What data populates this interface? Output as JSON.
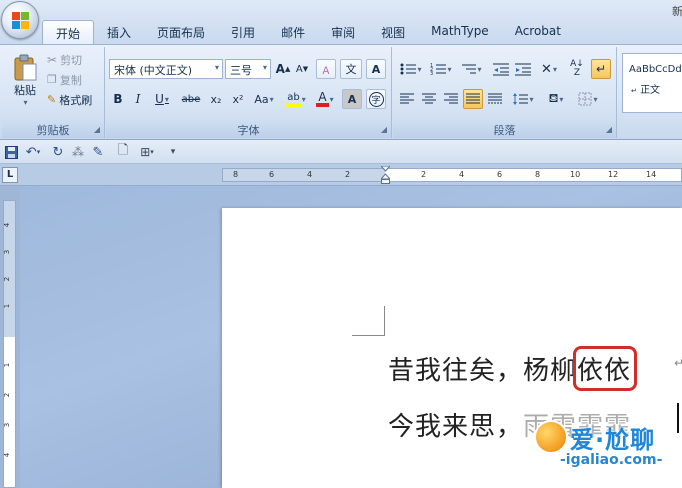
{
  "title_fragment": "新",
  "tabs": [
    {
      "label": "开始",
      "active": true
    },
    {
      "label": "插入"
    },
    {
      "label": "页面布局"
    },
    {
      "label": "引用"
    },
    {
      "label": "邮件"
    },
    {
      "label": "审阅"
    },
    {
      "label": "视图"
    },
    {
      "label": "MathType"
    },
    {
      "label": "Acrobat"
    }
  ],
  "clipboard": {
    "group_label": "剪贴板",
    "paste": "粘贴",
    "cut": "剪切",
    "copy": "复制",
    "format_painter": "格式刷"
  },
  "font": {
    "group_label": "字体",
    "font_name": "宋体 (中文正文)",
    "font_size": "三号",
    "buttons": {
      "grow": "A",
      "shrink": "A",
      "bold": "B",
      "italic": "I",
      "underline": "U",
      "strike": "abe",
      "subscript": "x₂",
      "superscript": "x²",
      "change_case": "Aa",
      "highlight": "ab",
      "font_color": "A",
      "char_shading": "A",
      "enclose": "字",
      "phonetic": "文",
      "char_border": "A",
      "change_case_symbol": "文"
    }
  },
  "paragraph": {
    "group_label": "段落"
  },
  "styles": {
    "sample": "AaBbCcDd",
    "name": "正文"
  },
  "ruler": {
    "tab_selector": "L",
    "left_ticks": [
      "8",
      "6",
      "4",
      "2"
    ],
    "right_ticks": [
      "2",
      "4",
      "6",
      "8",
      "10",
      "12",
      "14"
    ],
    "v_ticks": [
      "4",
      "3",
      "2",
      "1",
      "1",
      "2",
      "3",
      "4"
    ]
  },
  "document": {
    "line1_prefix": "昔我往矣，杨柳",
    "line1_highlight": "依依",
    "line2_prefix": "今我来思，",
    "line2_partial": "雨雪霏霏",
    "para_mark": "↵"
  },
  "watermark": {
    "brand": "爱·尬聊",
    "url": "-igaliao.com-"
  },
  "colors": {
    "highlight_circle": "#d42b2b",
    "ribbon_top": "#e9f0fa",
    "doc_bg": "#a9c1e2"
  }
}
